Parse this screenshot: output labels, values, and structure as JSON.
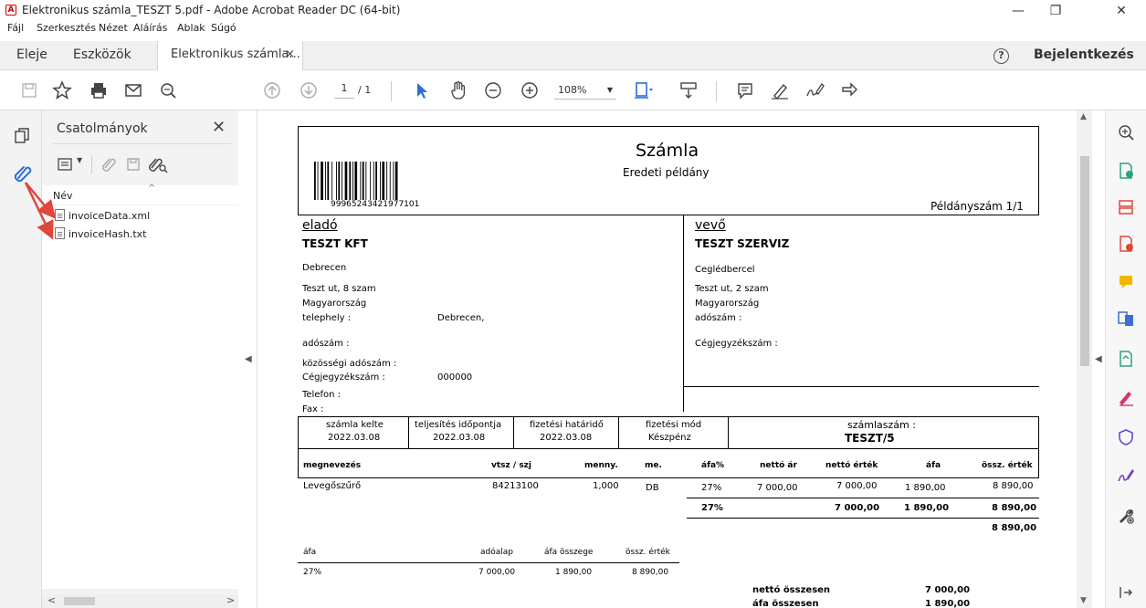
{
  "window": {
    "title": "Elektronikus számla_TESZT 5.pdf - Adobe Acrobat Reader DC (64-bit)",
    "min": "—",
    "max": "❐",
    "close": "✕"
  },
  "menu": [
    "Fájl",
    "Szerkesztés",
    "Nézet",
    "Aláírás",
    "Ablak",
    "Súgó"
  ],
  "tabs": {
    "home": "Eleje",
    "tools": "Eszközök",
    "doc": "Elektronikus számla...",
    "close": "×",
    "help": "?",
    "login": "Bejelentkezés"
  },
  "toolbar": {
    "page_current": "1",
    "page_total": "/ 1",
    "zoom": "108%",
    "zoom_caret": "▼"
  },
  "panel": {
    "title": "Csatolmányok",
    "close": "✕",
    "col_name": "Név",
    "col_caret": "^",
    "files": [
      "invoiceData.xml",
      "invoiceHash.txt"
    ]
  },
  "colors": {
    "accent": "#2b6fd6",
    "annotation": "#e0463a"
  },
  "invoice": {
    "title": "Számla",
    "subtitle": "Eredeti példány",
    "barcode_num": "99965243421977101",
    "copy_no": "Példányszám 1/1",
    "seller": {
      "label": "eladó",
      "name": "TESZT KFT",
      "city": "Debrecen",
      "street": "Teszt ut, 8 szam",
      "country": "Magyarország",
      "site_label": "telephely :",
      "site_value": "Debrecen,",
      "tax_label": "adószám :",
      "eu_tax_label": "közösségi adószám :",
      "reg_label": "Cégjegyzékszám :",
      "reg_value": "000000",
      "phone_label": "Telefon :",
      "fax_label": "Fax :"
    },
    "buyer": {
      "label": "vevő",
      "name": "TESZT SZERVIZ",
      "city": "Ceglédbercel",
      "street": "Teszt ut, 2 szam",
      "country": "Magyarország",
      "tax_label": "adószám :",
      "reg_label": "Cégjegyzékszám :"
    },
    "dates": {
      "issue_label": "számla kelte",
      "issue": "2022.03.08",
      "perf_label": "teljesítés időpontja",
      "perf": "2022.03.08",
      "due_label": "fizetési határidő",
      "due": "2022.03.08",
      "pay_label": "fizetési mód",
      "pay": "Készpénz",
      "no_label": "számlaszám :",
      "no": "TESZT/5"
    },
    "items_header": [
      "megnevezés",
      "vtsz / szj",
      "menny.",
      "me.",
      "áfa%",
      "nettó ár",
      "nettó érték",
      "áfa",
      "össz. érték"
    ],
    "item": [
      "Levegőszűrő",
      "84213100",
      "1,000",
      "DB",
      "27%",
      "7 000,00",
      "7 000,00",
      "1 890,00",
      "8 890,00"
    ],
    "subtotal": [
      "27%",
      "7 000,00",
      "1 890,00",
      "8 890,00"
    ],
    "grand_total": "8 890,00",
    "vat_header": [
      "áfa",
      "adóalap",
      "áfa összege",
      "össz. érték"
    ],
    "vat_row": [
      "27%",
      "7 000,00",
      "1 890,00",
      "8 890,00"
    ],
    "summary": {
      "net_label": "nettó összesen",
      "net": "7 000,00",
      "vat_label": "áfa összesen",
      "vat": "1 890,00"
    }
  }
}
